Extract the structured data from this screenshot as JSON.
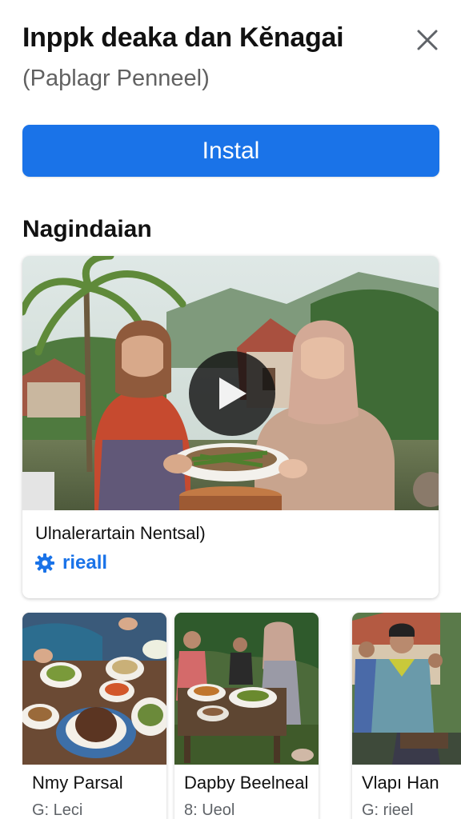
{
  "header": {
    "title": "Inppk deaka dan Kĕnagai",
    "subtitle": "(Paþlagr Penneel)",
    "close_icon": "close-icon"
  },
  "install": {
    "label": "Instal",
    "color": "#1a73e8"
  },
  "section": {
    "heading": "Nagindaian"
  },
  "featured": {
    "title": "Ulnalerartain Nentsal)",
    "meta_label": "rieall",
    "meta_icon": "gear-icon",
    "play_icon": "play-icon"
  },
  "cards": [
    {
      "title": "Nmy Parsal",
      "meta": "G: Leci"
    },
    {
      "title": "Dapby Beelneal",
      "meta": "8: Ueol"
    },
    {
      "title": "Vlapı Han",
      "meta": "G: rieel"
    }
  ]
}
